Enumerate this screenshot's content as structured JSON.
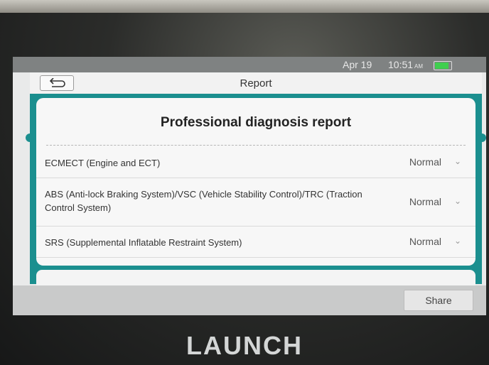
{
  "status_bar": {
    "date": "Apr 19",
    "time": "10:51",
    "ampm": "AM",
    "battery_color": "#3fcf4f",
    "battery_level": 0.85
  },
  "header": {
    "title": "Report",
    "back_icon": "return-arrow-icon"
  },
  "report": {
    "title": "Professional diagnosis report",
    "rows": [
      {
        "label": "ECMECT (Engine and ECT)",
        "status": "Normal"
      },
      {
        "label": "ABS (Anti-lock Braking System)/VSC (Vehicle Stability Control)/TRC (Traction Control System)",
        "status": "Normal"
      },
      {
        "label": "SRS (Supplemental Inflatable Restraint System)",
        "status": "Normal"
      }
    ]
  },
  "footer": {
    "share_label": "Share"
  },
  "brand": "LAUNCH",
  "colors": {
    "accent": "#1b8f8f"
  }
}
